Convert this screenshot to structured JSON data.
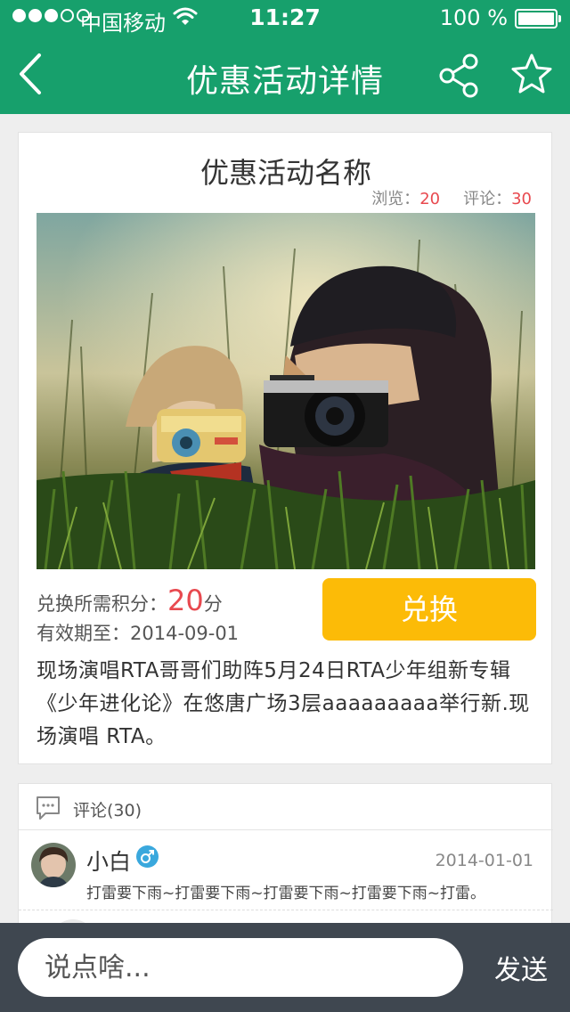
{
  "status_bar": {
    "carrier": "中国移动",
    "time": "11:27",
    "battery": "100 %",
    "signal_icon": "signal-dots-icon",
    "wifi_icon": "wifi-icon",
    "battery_icon": "battery-icon"
  },
  "nav": {
    "title": "优惠活动详情",
    "back_icon": "chevron-left-icon",
    "share_icon": "share-icon",
    "star_icon": "star-icon"
  },
  "activity": {
    "title": "优惠活动名称",
    "views_label": "浏览：",
    "views": "20",
    "comments_label": "评论：",
    "comments": "30",
    "points_label": "兑换所需积分：",
    "points_value": "20",
    "points_unit": "分",
    "expiry_label": "有效期至：",
    "expiry_date": "2014-09-01",
    "redeem_label": "兑换",
    "description": "现场演唱RTA哥哥们助阵5月24日RTA少年组新专辑《少年进化论》在悠唐广场3层aaaaaaaaa举行新.现场演唱 RTA。"
  },
  "comments_section": {
    "title": "评论(30)",
    "icon": "comment-bubble-icon",
    "items": [
      {
        "user": "小白",
        "gender_icon": "male-icon",
        "date": "2014-01-01",
        "text": "打雷要下雨~打雷要下雨~打雷要下雨~打雷要下雨~打雷。"
      }
    ]
  },
  "input_bar": {
    "placeholder": "说点啥...",
    "send_label": "发送"
  },
  "colors": {
    "primary": "#17a06c",
    "accent_number": "#e8494f",
    "button": "#fcbb07",
    "input_bar_bg": "#3f4750",
    "male_badge": "#3aa8dd"
  }
}
